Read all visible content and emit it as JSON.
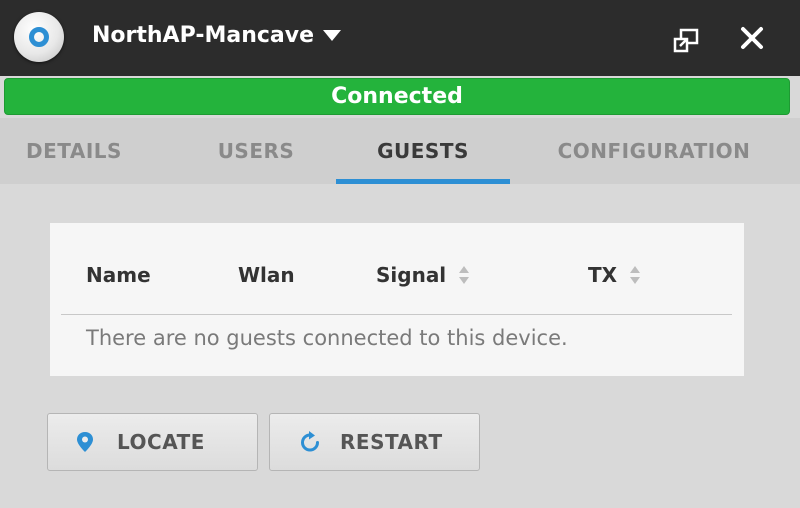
{
  "header": {
    "device_name": "NorthAP-Mancave",
    "icons": {
      "logo": "device-logo-icon",
      "dropdown": "caret-down-icon",
      "popout": "popout-icon",
      "close": "close-icon"
    }
  },
  "status": {
    "label": "Connected",
    "color": "#24b33c"
  },
  "tabs": [
    {
      "label": "DETAILS",
      "active": false
    },
    {
      "label": "USERS",
      "active": false
    },
    {
      "label": "GUESTS",
      "active": true
    },
    {
      "label": "CONFIGURATION",
      "active": false
    }
  ],
  "table": {
    "columns": [
      "Name",
      "Wlan",
      "Signal",
      "TX"
    ],
    "empty_message": "There are no guests connected to this device."
  },
  "actions": {
    "locate_label": "LOCATE",
    "restart_label": "RESTART"
  },
  "colors": {
    "accent": "#2d8fd4",
    "header_bg": "#2c2c2c"
  }
}
